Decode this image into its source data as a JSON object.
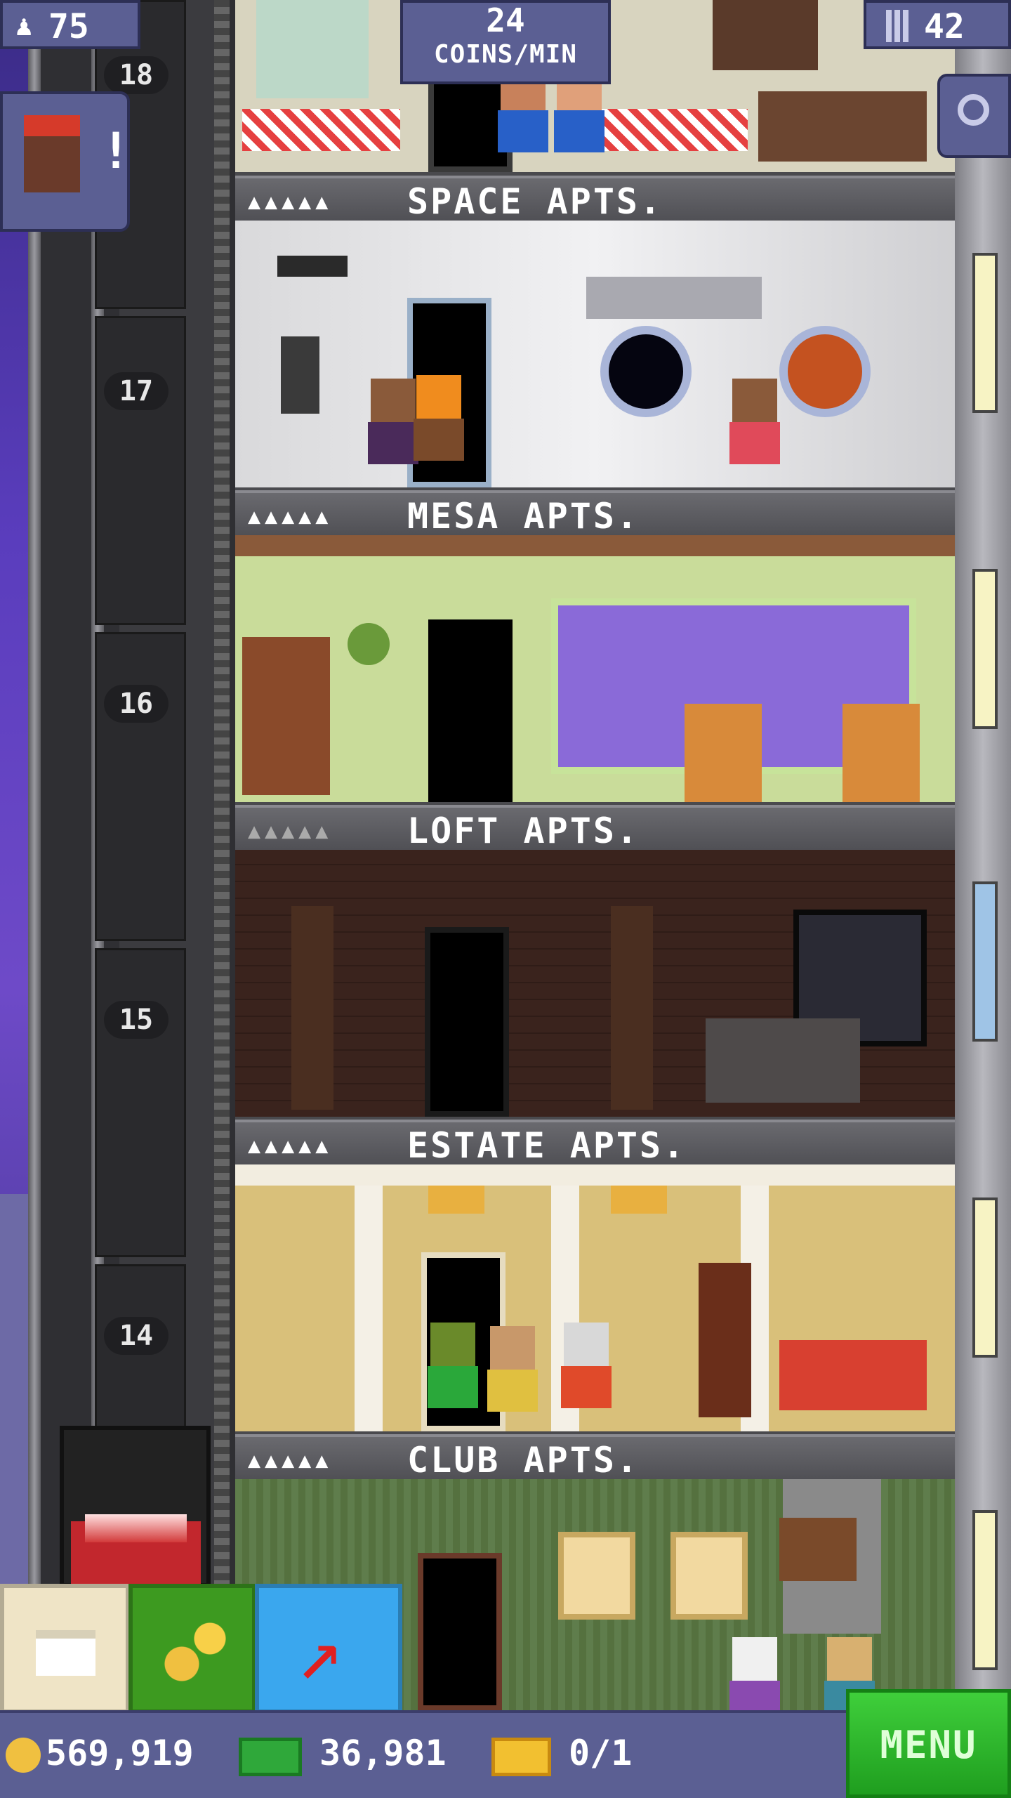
{
  "hud": {
    "population": "75",
    "coins_rate_value": "24",
    "coins_rate_unit": "COINS/MIN",
    "floors_count": "42"
  },
  "icons": {
    "population": "person-icon",
    "floors": "building-icon",
    "search": "magnifier-icon",
    "notification": "bitizen-alert-icon"
  },
  "notification_badge": "!",
  "floors": [
    {
      "number": "18",
      "name": "SPACE APTS.",
      "rating_dots": "▲▲▲▲▲"
    },
    {
      "number": "17",
      "name": "MESA APTS.",
      "rating_dots": "▲▲▲▲▲"
    },
    {
      "number": "16",
      "name": "LOFT APTS.",
      "rating_dots": "▲▲▲▲▲"
    },
    {
      "number": "15",
      "name": "ESTATE APTS.",
      "rating_dots": "▲▲▲▲▲"
    },
    {
      "number": "14",
      "name": "CLUB APTS.",
      "rating_dots": "▲▲▲▲▲"
    }
  ],
  "toolbar": {
    "build_button": "raise-icon",
    "coins_button": "coins-icon",
    "arrow_button": "arrow-up-icon",
    "menu_label": "MENU"
  },
  "currencies": {
    "coins": "569,919",
    "bux": "36,981",
    "tickets": "0/1"
  },
  "colors": {
    "hud_bg": "#5b5f93",
    "menu_green": "#2fbf2f",
    "arrow_button_blue": "#3aa7ee",
    "coins_button_green": "#3d9a20"
  }
}
